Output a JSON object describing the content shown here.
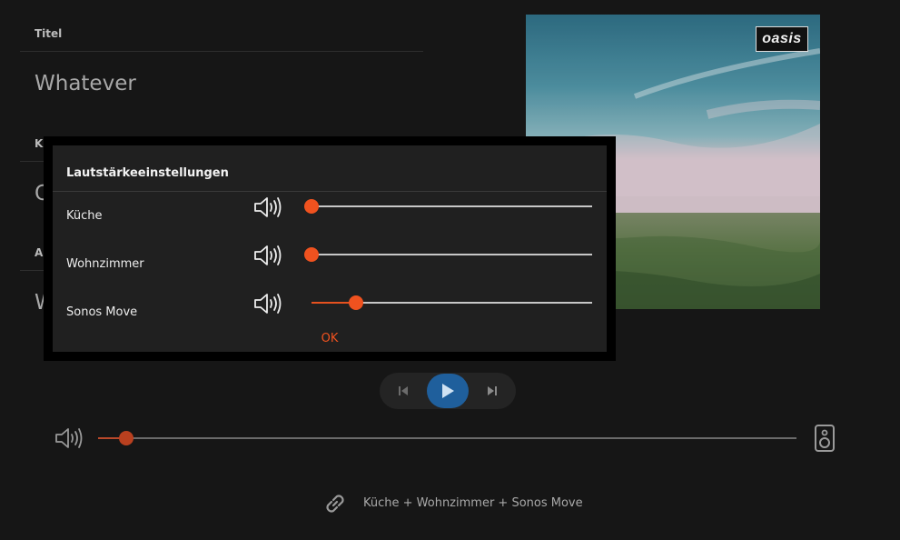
{
  "info": {
    "title_label": "Titel",
    "title_value": "Whatever",
    "label2_visible": "K",
    "value2_visible": "C",
    "label3_visible": "A",
    "value3_visible": "W"
  },
  "cover": {
    "logo_text": "oasis"
  },
  "dialog": {
    "title": "Lautstärkeeinstellungen",
    "rooms": [
      {
        "name": "Küche",
        "volume_percent": 0
      },
      {
        "name": "Wohnzimmer",
        "volume_percent": 0
      },
      {
        "name": "Sonos Move",
        "volume_percent": 16
      }
    ],
    "ok_label": "OK"
  },
  "transport": {
    "prev_icon": "skip-previous-icon",
    "play_icon": "play-icon",
    "next_icon": "skip-next-icon"
  },
  "master_volume": {
    "volume_percent": 4,
    "icon": "speaker-volume-icon",
    "output_icon": "speaker-device-icon"
  },
  "group": {
    "icon": "link-icon",
    "text": "Küche + Wohnzimmer + Sonos Move"
  },
  "colors": {
    "accent": "#f0521f",
    "play": "#1f5f9c",
    "background": "#161616",
    "dialog": "#202020"
  }
}
